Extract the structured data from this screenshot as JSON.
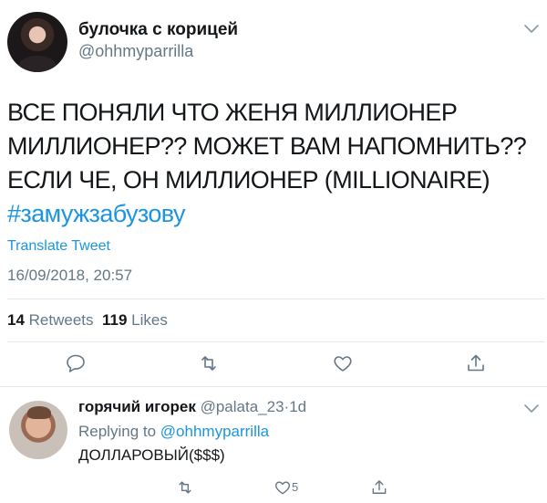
{
  "tweet": {
    "author_name": "булочка с корицей",
    "author_handle": "@ohhmyparrilla",
    "text_lines": [
      "ВСЕ ПОНЯЛИ ЧТО ЖЕНЯ МИЛЛИОНЕР",
      "МИЛЛИОНЕР?? МОЖЕТ ВАМ НАПОМНИТЬ??",
      "ЕСЛИ ЧЕ, ОН МИЛЛИОНЕР (MILLIONAIRE)"
    ],
    "hashtag": "#замужзабузову",
    "translate_label": "Translate Tweet",
    "timestamp": "16/09/2018, 20:57",
    "retweets_count": "14",
    "retweets_label": "Retweets",
    "likes_count": "119",
    "likes_label": "Likes"
  },
  "actions": {
    "reply_icon": "reply-icon",
    "retweet_icon": "retweet-icon",
    "like_icon": "heart-icon",
    "share_icon": "share-icon"
  },
  "reply": {
    "author_name": "горячий игорек",
    "author_handle": "@palata_23",
    "separator": "·",
    "time": "1d",
    "replying_prefix": "Replying to",
    "replying_to": "@ohhmyparrilla",
    "text": "ДОЛЛАРОВЫЙ($$$)",
    "like_count": "5"
  },
  "colors": {
    "link": "#1b95e0",
    "muted": "#657786",
    "text": "#14171a",
    "divider": "#e1e8ed"
  }
}
